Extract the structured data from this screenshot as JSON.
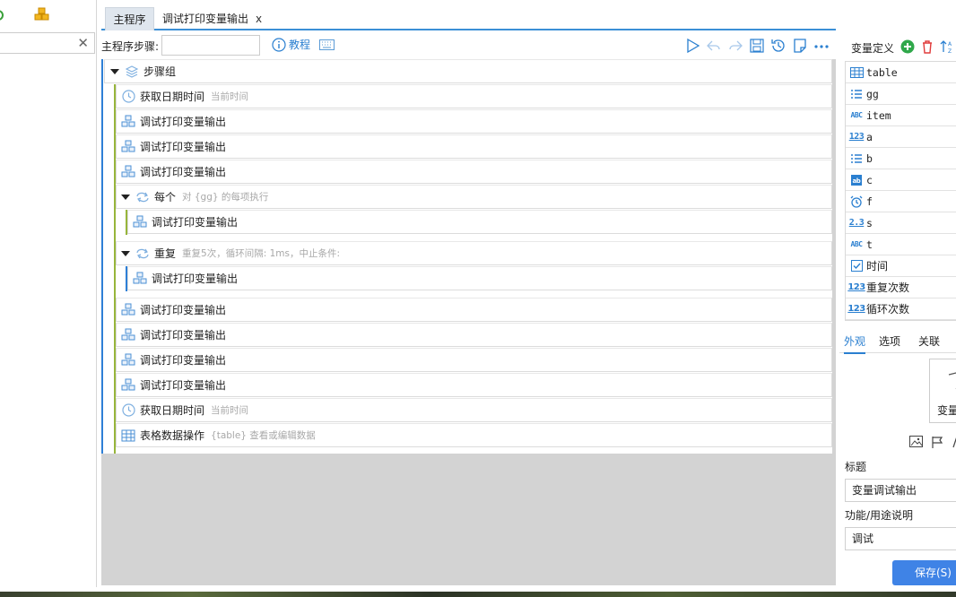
{
  "tabs": {
    "main": "主程序",
    "debug": "调试打印变量输出",
    "close": "x"
  },
  "toolbar": {
    "step_label": "主程序步骤:",
    "tutorial": "教程"
  },
  "flow": {
    "group": "步骤组",
    "steps": [
      {
        "name": "获取日期时间",
        "sub": "当前时间",
        "icon": "clock"
      },
      {
        "name": "调试打印变量输出",
        "sub": "",
        "icon": "cubes"
      },
      {
        "name": "调试打印变量输出",
        "sub": "",
        "icon": "cubes"
      },
      {
        "name": "调试打印变量输出",
        "sub": "",
        "icon": "cubes"
      }
    ],
    "each": {
      "name": "每个",
      "sub": "对 {gg} 的每项执行",
      "child": "调试打印变量输出"
    },
    "repeat": {
      "name": "重复",
      "sub": "重复5次，循环间隔: 1ms，中止条件:",
      "child": "调试打印变量输出"
    },
    "tail": [
      {
        "name": "调试打印变量输出",
        "sub": "",
        "icon": "cubes"
      },
      {
        "name": "调试打印变量输出",
        "sub": "",
        "icon": "cubes"
      },
      {
        "name": "调试打印变量输出",
        "sub": "",
        "icon": "cubes"
      },
      {
        "name": "调试打印变量输出",
        "sub": "",
        "icon": "cubes"
      },
      {
        "name": "获取日期时间",
        "sub": "当前时间",
        "icon": "clock"
      },
      {
        "name": "表格数据操作",
        "sub": "{table} 查看或编辑数据",
        "icon": "grid"
      }
    ]
  },
  "vars": {
    "title": "变量定义",
    "items": [
      {
        "name": "table",
        "type": "table"
      },
      {
        "name": "gg",
        "type": "list"
      },
      {
        "name": "item",
        "type": "ABC"
      },
      {
        "name": "a",
        "type": "123"
      },
      {
        "name": "b",
        "type": "list"
      },
      {
        "name": "c",
        "type": "ab"
      },
      {
        "name": "f",
        "type": "alarm"
      },
      {
        "name": "s",
        "type": "2.3"
      },
      {
        "name": "t",
        "type": "ABC"
      },
      {
        "name": "时间",
        "type": "check"
      },
      {
        "name": "重复次数",
        "type": "123"
      },
      {
        "name": "循环次数",
        "type": "123"
      }
    ]
  },
  "props": {
    "tabs": [
      "外观",
      "选项",
      "关联"
    ],
    "preview_text": "变量",
    "title_label": "标题",
    "title_value": "变量调试输出",
    "desc_label": "功能/用途说明",
    "desc_value": "调试",
    "save": "保存(S)"
  },
  "colors": {
    "accent": "#3f83e6",
    "link": "#2a7fd0",
    "group_bar": "#2e7fd6",
    "each_bar": "#97b53b",
    "repeat_bar": "#2e7fd6"
  }
}
